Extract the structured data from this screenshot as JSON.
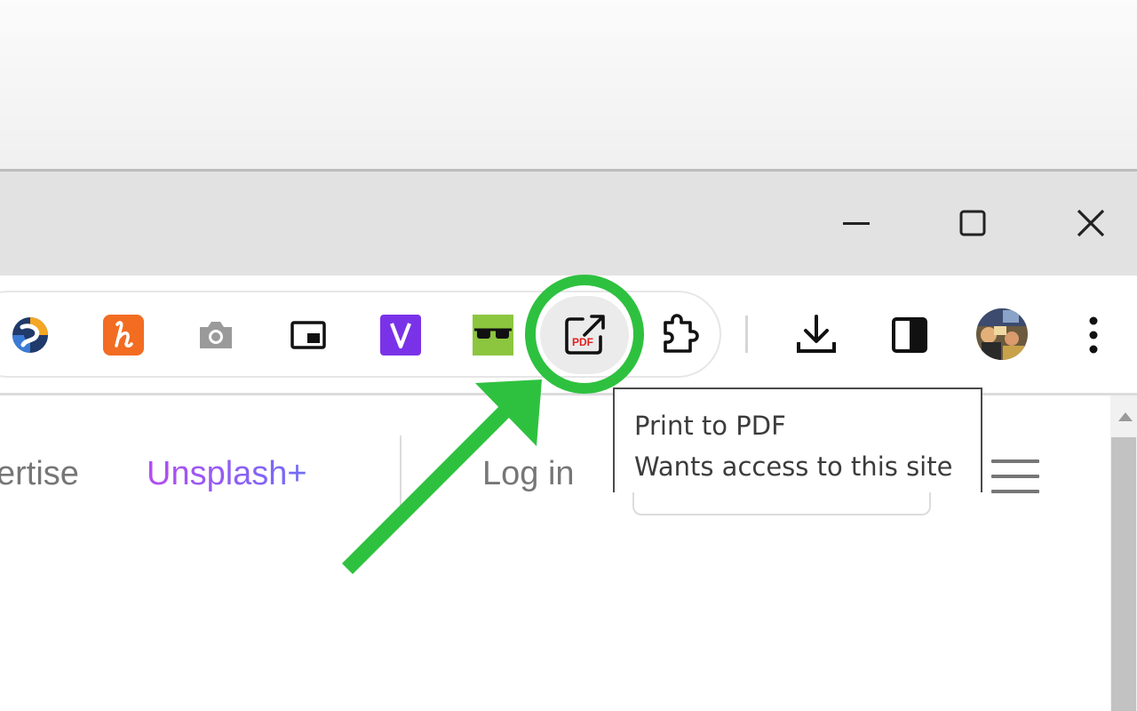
{
  "window": {
    "controls": [
      "minimize",
      "maximize",
      "close"
    ]
  },
  "toolbar": {
    "extensions": [
      {
        "name": "Extension (blue/orange logo)",
        "icon": "circle-logo-icon"
      },
      {
        "name": "Honey",
        "icon": "honey-h-icon",
        "color": "#f26c22"
      },
      {
        "name": "Screenshot",
        "icon": "camera-icon"
      },
      {
        "name": "Picture-in-Picture",
        "icon": "picture-in-picture-icon"
      },
      {
        "name": "Extension V",
        "icon": "v-logo-icon",
        "color": "#7a32e8"
      },
      {
        "name": "Reader glasses",
        "icon": "glasses-icon",
        "color": "#8cc63f"
      },
      {
        "name": "Print to PDF",
        "icon": "pdf-export-icon",
        "highlighted": true
      },
      {
        "name": "Extensions",
        "icon": "puzzle-icon"
      }
    ],
    "actions": [
      "download-icon",
      "side-panel-icon",
      "profile-avatar",
      "more-menu-icon"
    ]
  },
  "tooltip": {
    "title": "Print to PDF",
    "subtitle": "Wants access to this site"
  },
  "page": {
    "nav_advertise": "ertise",
    "nav_unsplash_plus": "Unsplash+",
    "nav_login": "Log in"
  },
  "annotation": {
    "color": "#2ec13f",
    "shapes": [
      "highlight-circle",
      "pointer-arrow"
    ]
  }
}
